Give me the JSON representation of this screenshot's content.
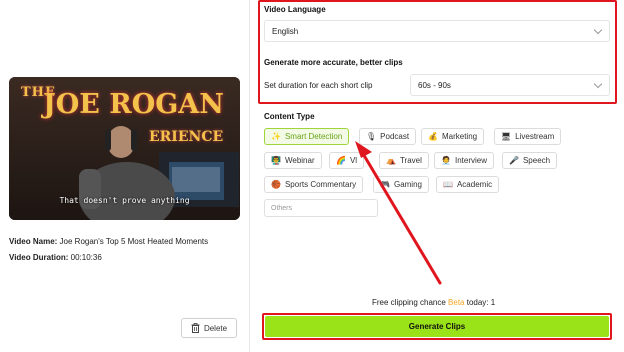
{
  "video": {
    "caption": "That doesn't prove anything",
    "name_label": "Video Name:",
    "name_value": "Joe Rogan's Top 5 Most Heated Moments",
    "duration_label": "Video Duration:",
    "duration_value": "00:10:36",
    "delete_label": "Delete",
    "logo_text_1": "THE",
    "logo_text_2": "JOE ROGAN",
    "logo_text_3": "ERIENCE"
  },
  "settings": {
    "language_title": "Video Language",
    "language_value": "English",
    "accuracy_title": "Generate more accurate, better clips",
    "duration_label": "Set duration for each short clip",
    "duration_value": "60s - 90s"
  },
  "content_type": {
    "title": "Content Type",
    "chips": [
      {
        "label": "Smart Detection",
        "icon": "✨",
        "icon_name": "sparkle-icon"
      },
      {
        "label": "Podcast",
        "icon": "🎙",
        "icon_name": "microphone-icon"
      },
      {
        "label": "Marketing",
        "icon": "💰",
        "icon_name": "money-bag-icon"
      },
      {
        "label": "Livestream",
        "icon": "🖥",
        "icon_name": "monitor-icon"
      },
      {
        "label": "Webinar",
        "icon": "👨‍🏫",
        "icon_name": "teacher-icon"
      },
      {
        "label": "Vl",
        "icon": "🌈",
        "icon_name": "rainbow-icon"
      },
      {
        "label": "Travel",
        "icon": "⛺",
        "icon_name": "tent-icon"
      },
      {
        "label": "Interview",
        "icon": "🧑‍💼",
        "icon_name": "person-icon"
      },
      {
        "label": "Speech",
        "icon": "🎤",
        "icon_name": "microphone-icon"
      },
      {
        "label": "Sports Commentary",
        "icon": "🏀",
        "icon_name": "basketball-icon"
      },
      {
        "label": "Gaming",
        "icon": "🎮",
        "icon_name": "gamepad-icon"
      },
      {
        "label": "Academic",
        "icon": "📖",
        "icon_name": "book-icon"
      }
    ],
    "others_placeholder": "Others"
  },
  "footer": {
    "free_prefix": "Free clipping chance ",
    "free_beta": "Beta",
    "free_suffix": " today: 1",
    "generate_label": "Generate Clips"
  },
  "colors": {
    "accent_green": "#9be319",
    "highlight_red": "#e0161e",
    "beta_orange": "#f5a623"
  }
}
